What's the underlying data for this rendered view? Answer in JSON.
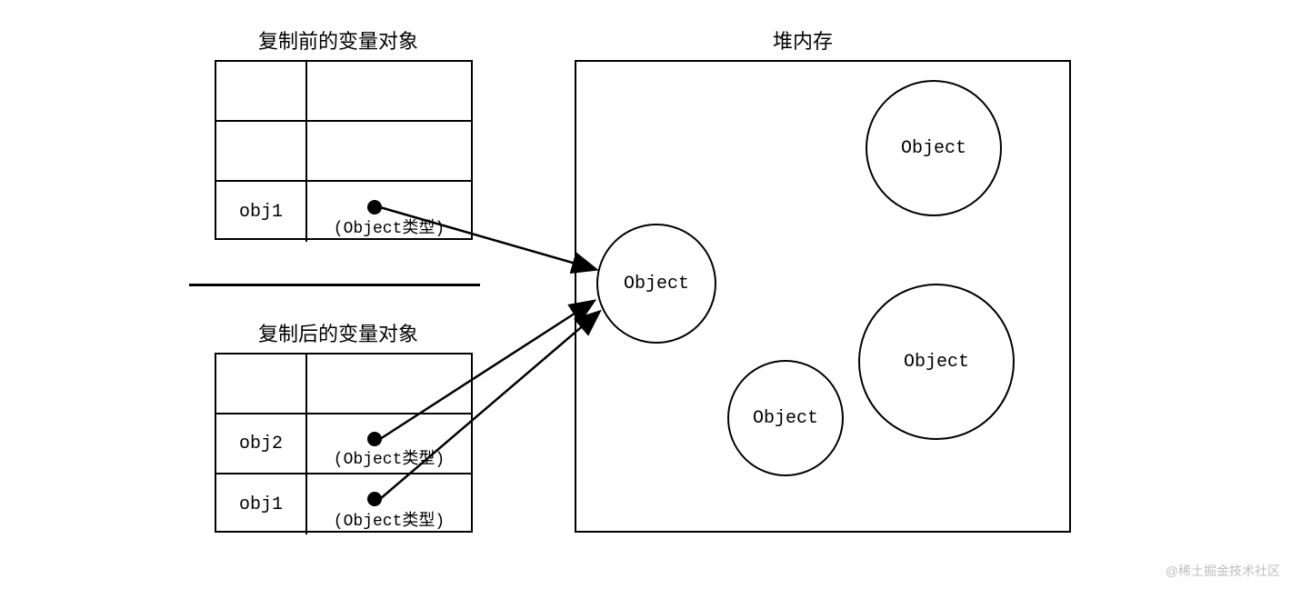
{
  "titles": {
    "table_before": "复制前的变量对象",
    "table_after": "复制后的变量对象",
    "heap": "堆内存"
  },
  "table_before": {
    "rows": [
      {
        "var": "",
        "val": ""
      },
      {
        "var": "",
        "val": ""
      },
      {
        "var": "obj1",
        "val": "(Object类型)"
      }
    ]
  },
  "table_after": {
    "rows": [
      {
        "var": "",
        "val": ""
      },
      {
        "var": "obj2",
        "val": "(Object类型)"
      },
      {
        "var": "obj1",
        "val": "(Object类型)"
      }
    ]
  },
  "heap_objects": {
    "target": "Object",
    "top_right": "Object",
    "bottom_mid": "Object",
    "bottom_right": "Object"
  },
  "watermark": "@稀土掘金技术社区"
}
